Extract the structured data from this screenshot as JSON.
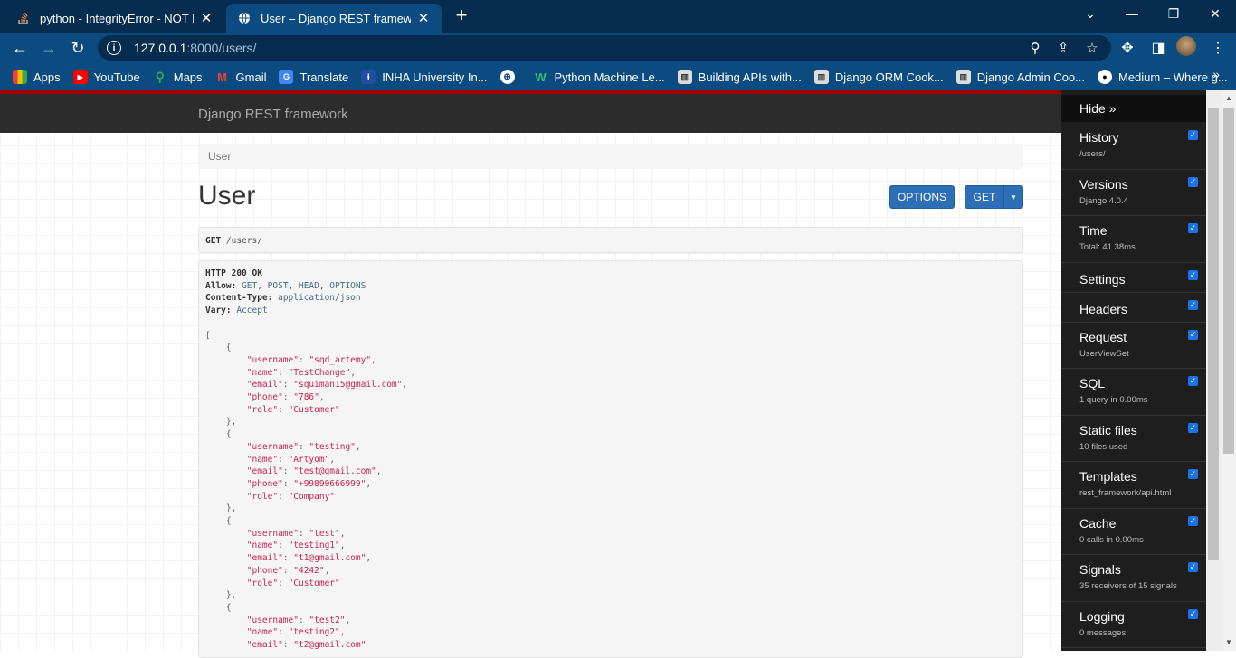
{
  "browser": {
    "tabs": [
      {
        "title": "python - IntegrityError - NOT NU",
        "icon": "stackoverflow-icon"
      },
      {
        "title": "User – Django REST framework",
        "icon": "globe-icon"
      }
    ],
    "url_host": "127.0.0.1",
    "url_rest": ":8000/users/",
    "bookmarks": [
      {
        "label": "Apps",
        "icon": "apps-grid-icon"
      },
      {
        "label": "YouTube",
        "icon": "youtube-icon"
      },
      {
        "label": "Maps",
        "icon": "maps-icon"
      },
      {
        "label": "Gmail",
        "icon": "gmail-icon"
      },
      {
        "label": "Translate",
        "icon": "translate-icon"
      },
      {
        "label": "INHA University In...",
        "icon": "inha-icon"
      },
      {
        "label": "",
        "icon": "globe-icon"
      },
      {
        "label": "Python Machine Le...",
        "icon": "w-logo-icon"
      },
      {
        "label": "Building APIs with...",
        "icon": "book-icon"
      },
      {
        "label": "Django ORM Cook...",
        "icon": "book-icon"
      },
      {
        "label": "Django Admin Coo...",
        "icon": "book-icon"
      },
      {
        "label": "Medium – Where g...",
        "icon": "medium-icon"
      }
    ]
  },
  "page": {
    "brand": "Django REST framework",
    "breadcrumb": "User",
    "title": "User",
    "options_label": "OPTIONS",
    "get_label": "GET",
    "request_method": "GET",
    "request_path": "/users/",
    "response_headers": [
      {
        "key": "HTTP 200 OK",
        "value": ""
      },
      {
        "key": "Allow:",
        "value": "GET, POST, HEAD, OPTIONS"
      },
      {
        "key": "Content-Type:",
        "value": "application/json"
      },
      {
        "key": "Vary:",
        "value": "Accept"
      }
    ],
    "users": [
      {
        "username": "sqd_artemy",
        "name": "TestChange",
        "email": "squiman15@gmail.com",
        "phone": "786",
        "role": "Customer"
      },
      {
        "username": "testing",
        "name": "Artyom",
        "email": "test@gmail.com",
        "phone": "+99890666999",
        "role": "Company"
      },
      {
        "username": "test",
        "name": "testing1",
        "email": "t1@gmail.com",
        "phone": "4242",
        "role": "Customer"
      },
      {
        "username": "test2",
        "name": "testing2",
        "email": "t2@gmail.com"
      }
    ]
  },
  "debug_toolbar": {
    "hide_label": "Hide »",
    "panels": [
      {
        "title": "History",
        "subtitle": "/users/"
      },
      {
        "title": "Versions",
        "subtitle": "Django 4.0.4"
      },
      {
        "title": "Time",
        "subtitle": "Total: 41.38ms"
      },
      {
        "title": "Settings",
        "subtitle": ""
      },
      {
        "title": "Headers",
        "subtitle": ""
      },
      {
        "title": "Request",
        "subtitle": "UserViewSet"
      },
      {
        "title": "SQL",
        "subtitle": "1 query in 0.00ms"
      },
      {
        "title": "Static files",
        "subtitle": "10 files used"
      },
      {
        "title": "Templates",
        "subtitle": "rest_framework/api.html"
      },
      {
        "title": "Cache",
        "subtitle": "0 calls in 0.00ms"
      },
      {
        "title": "Signals",
        "subtitle": "35 receivers of 15 signals"
      },
      {
        "title": "Logging",
        "subtitle": "0 messages"
      }
    ]
  },
  "colors": {
    "tabstrip": "#062d50",
    "toolbar": "#0b4b7f",
    "drf_navbar": "#2c2c2c",
    "drf_redbar": "#a30000",
    "button": "#2c6fb7",
    "json_string": "#c7254e"
  }
}
